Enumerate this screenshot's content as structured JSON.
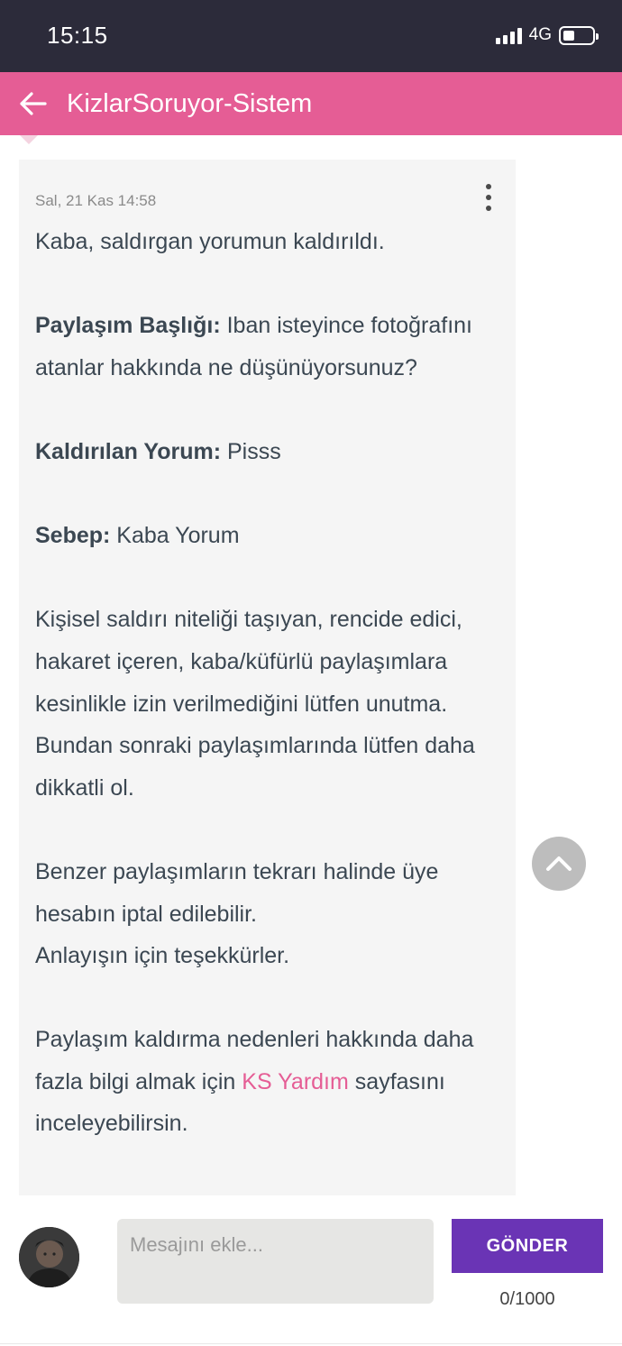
{
  "status_bar": {
    "time": "15:15",
    "network": "4G"
  },
  "header": {
    "title": "KizlarSoruyor-Sistem",
    "back_icon": "arrow-left-icon",
    "color": "#e55d95"
  },
  "message": {
    "date": "Sal, 21 Kas 14:58",
    "intro": "Kaba, saldırgan yorumun kaldırıldı.",
    "post_title_label": "Paylaşım Başlığı:",
    "post_title_value": " Iban isteyince fotoğrafını atanlar hakkında ne düşünüyorsunuz?",
    "removed_comment_label": "Kaldırılan Yorum:",
    "removed_comment_value": " Pisss",
    "reason_label": "Sebep:",
    "reason_value": " Kaba Yorum",
    "warning": "Kişisel saldırı niteliği taşıyan, rencide edici, hakaret içeren, kaba/küfürlü paylaşımlara kesinlikle izin verilmediğini lütfen unutma. Bundan sonraki paylaşımlarında lütfen daha dikkatli ol.",
    "account_warning": "Benzer paylaşımların tekrarı halinde üye hesabın iptal edilebilir.",
    "thanks": "Anlayışın için teşekkürler.",
    "help_before": "Paylaşım kaldırma nedenleri hakkında daha fazla bilgi almak için ",
    "help_link": "KS Yardım",
    "help_after": " sayfasını inceleyebilirsin."
  },
  "compose": {
    "placeholder": "Mesajını ekle...",
    "send_label": "GÖNDER",
    "char_count": "0/1000",
    "send_color": "#6a34b5"
  }
}
